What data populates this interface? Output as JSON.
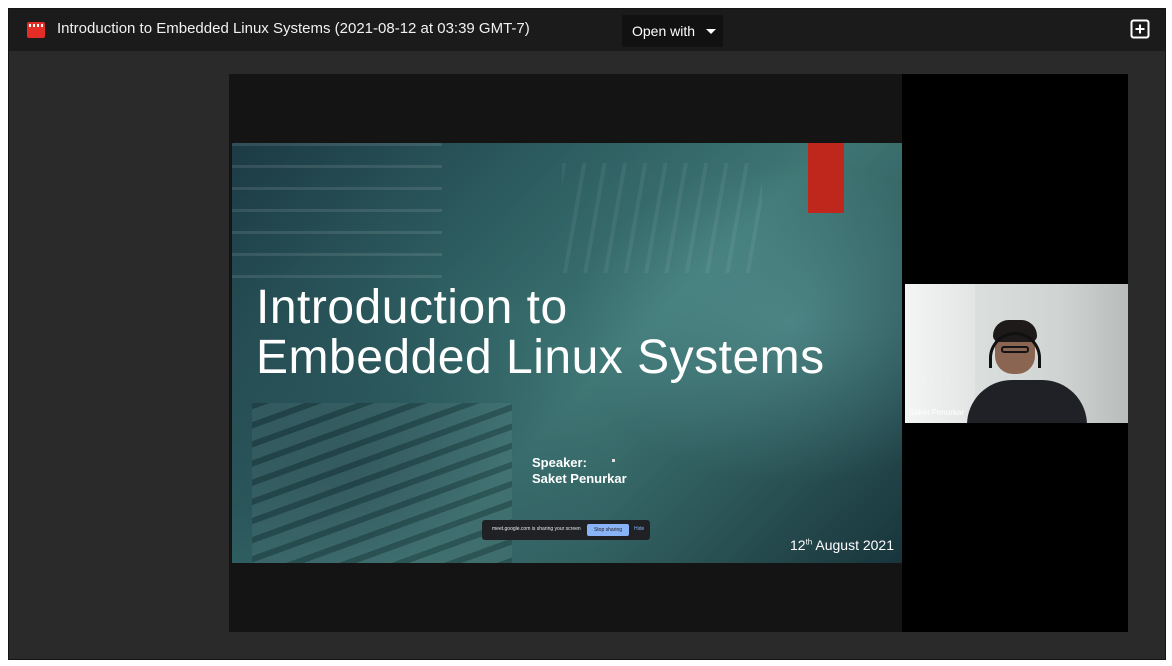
{
  "header": {
    "file_title": "Introduction to Embedded Linux Systems (2021-08-12 at 03:39 GMT-7)",
    "open_with_label": "Open with",
    "file_icon": "video-file-icon",
    "add_icon": "add-to-drive-icon"
  },
  "slide": {
    "title_line1": "Introduction to",
    "title_line2": "Embedded Linux Systems",
    "speaker_label": "Speaker:",
    "speaker_name": "Saket Penurkar",
    "date_day": "12",
    "date_suffix": "th",
    "date_rest": " August 2021",
    "accent_color": "#c0271c"
  },
  "share_bar": {
    "message": "meet.google.com is sharing your screen",
    "stop_label": "Stop sharing",
    "hide_label": "Hide"
  },
  "participant": {
    "name": "Saket Penurkar"
  },
  "colors": {
    "page_background": "#2a2a2a",
    "topbar_background": "#1b1b1b",
    "file_icon_red": "#e52d27"
  }
}
